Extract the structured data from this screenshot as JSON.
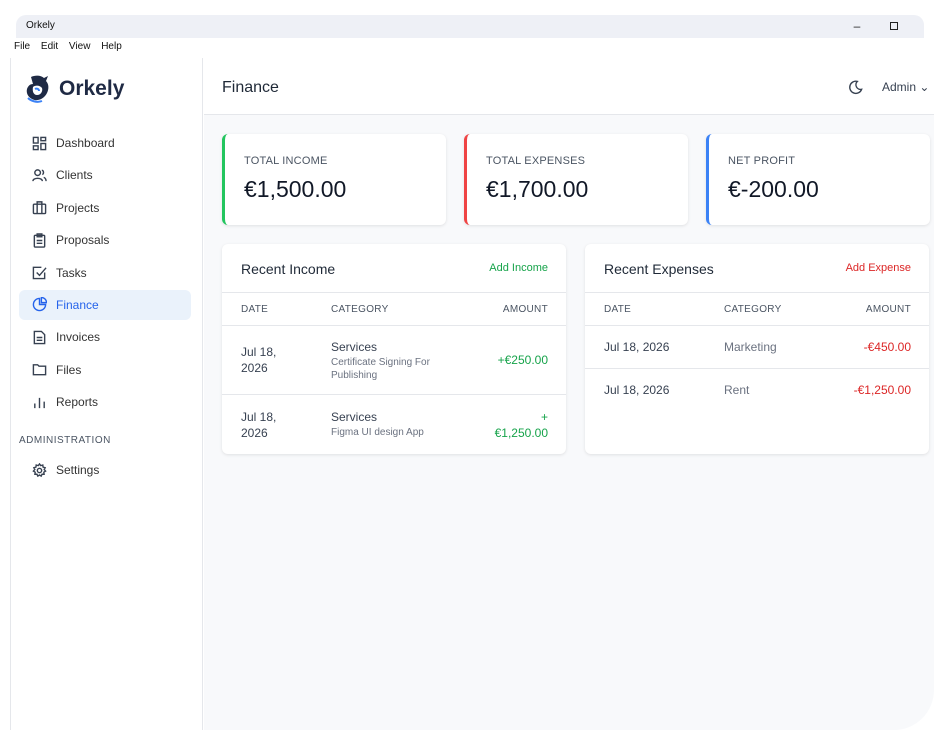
{
  "window": {
    "title": "Orkely",
    "minimize": "–"
  },
  "menu": [
    "File",
    "Edit",
    "View",
    "Help"
  ],
  "brand": {
    "name": "Orkely",
    "accent": "#2563eb"
  },
  "sidebar": {
    "items": [
      {
        "label": "Dashboard",
        "icon": "dashboard-icon"
      },
      {
        "label": "Clients",
        "icon": "users-icon"
      },
      {
        "label": "Projects",
        "icon": "briefcase-icon"
      },
      {
        "label": "Proposals",
        "icon": "clipboard-icon"
      },
      {
        "label": "Tasks",
        "icon": "checkbox-icon"
      },
      {
        "label": "Finance",
        "icon": "pie-chart-icon",
        "active": true
      },
      {
        "label": "Invoices",
        "icon": "document-icon"
      },
      {
        "label": "Files",
        "icon": "folder-icon"
      },
      {
        "label": "Reports",
        "icon": "bar-chart-icon"
      }
    ],
    "section_title": "ADMINISTRATION",
    "admin_items": [
      {
        "label": "Settings",
        "icon": "gear-icon"
      }
    ]
  },
  "header": {
    "title": "Finance",
    "user": "Admin ⌄"
  },
  "stats": [
    {
      "label": "TOTAL INCOME",
      "value": "€1,500.00",
      "color": "#22c55e"
    },
    {
      "label": "TOTAL EXPENSES",
      "value": "€1,700.00",
      "color": "#ef4444"
    },
    {
      "label": "NET PROFIT",
      "value": "€-200.00",
      "color": "#3b82f6"
    }
  ],
  "income": {
    "title": "Recent Income",
    "action": "Add Income",
    "action_color": "#16a34a",
    "columns": [
      "DATE",
      "CATEGORY",
      "AMOUNT"
    ],
    "rows": [
      {
        "date": "Jul 18, 2026",
        "category": "Services",
        "description": "Certificate Signing For Publishing",
        "amount": "+€250.00"
      },
      {
        "date": "Jul 18, 2026",
        "category": "Services",
        "description": "Figma UI design App",
        "amount": "+ €1,250.00"
      }
    ]
  },
  "expenses": {
    "title": "Recent Expenses",
    "action": "Add Expense",
    "action_color": "#dc2626",
    "columns": [
      "DATE",
      "CATEGORY",
      "AMOUNT"
    ],
    "rows": [
      {
        "date": "Jul 18, 2026",
        "category": "Marketing",
        "amount": "-€450.00"
      },
      {
        "date": "Jul 18, 2026",
        "category": "Rent",
        "amount": "-€1,250.00"
      }
    ]
  }
}
